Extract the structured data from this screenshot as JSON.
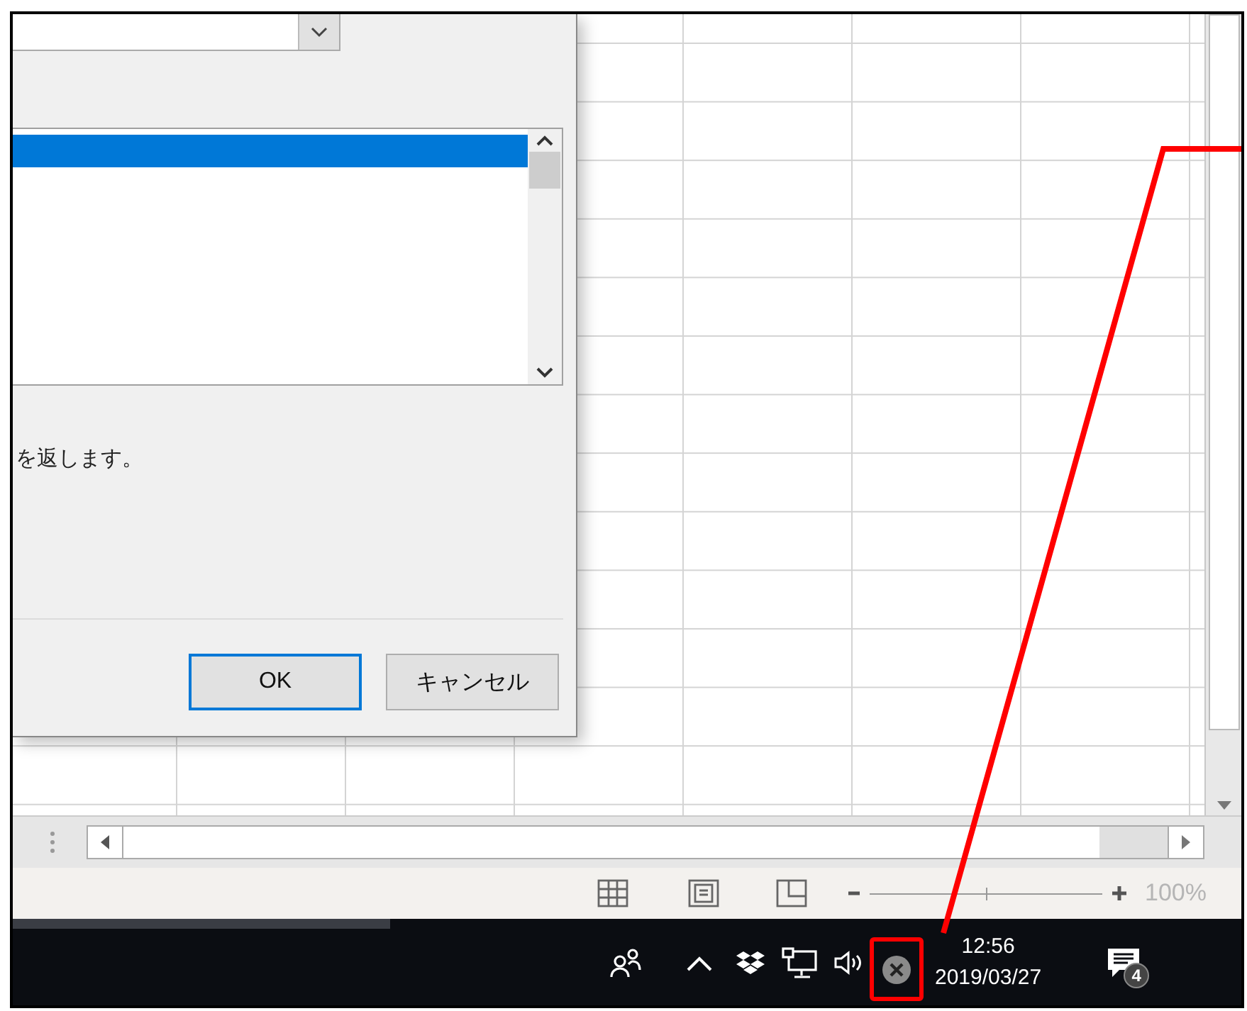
{
  "dialog": {
    "function_list": {
      "rows": [
        {
          "selected": true
        }
      ]
    },
    "description": "を返します。",
    "buttons": [
      {
        "label": "OK",
        "default": true
      },
      {
        "label": "キャンセル",
        "default": false
      }
    ]
  },
  "status_bar": {
    "zoom": {
      "level": 0.5,
      "reading": "100%"
    }
  },
  "taskbar": {
    "clock": {
      "time": "12:56",
      "date": "2019/03/27"
    },
    "notifications": {
      "count": "4"
    },
    "highlighted_tray_icon": true
  }
}
